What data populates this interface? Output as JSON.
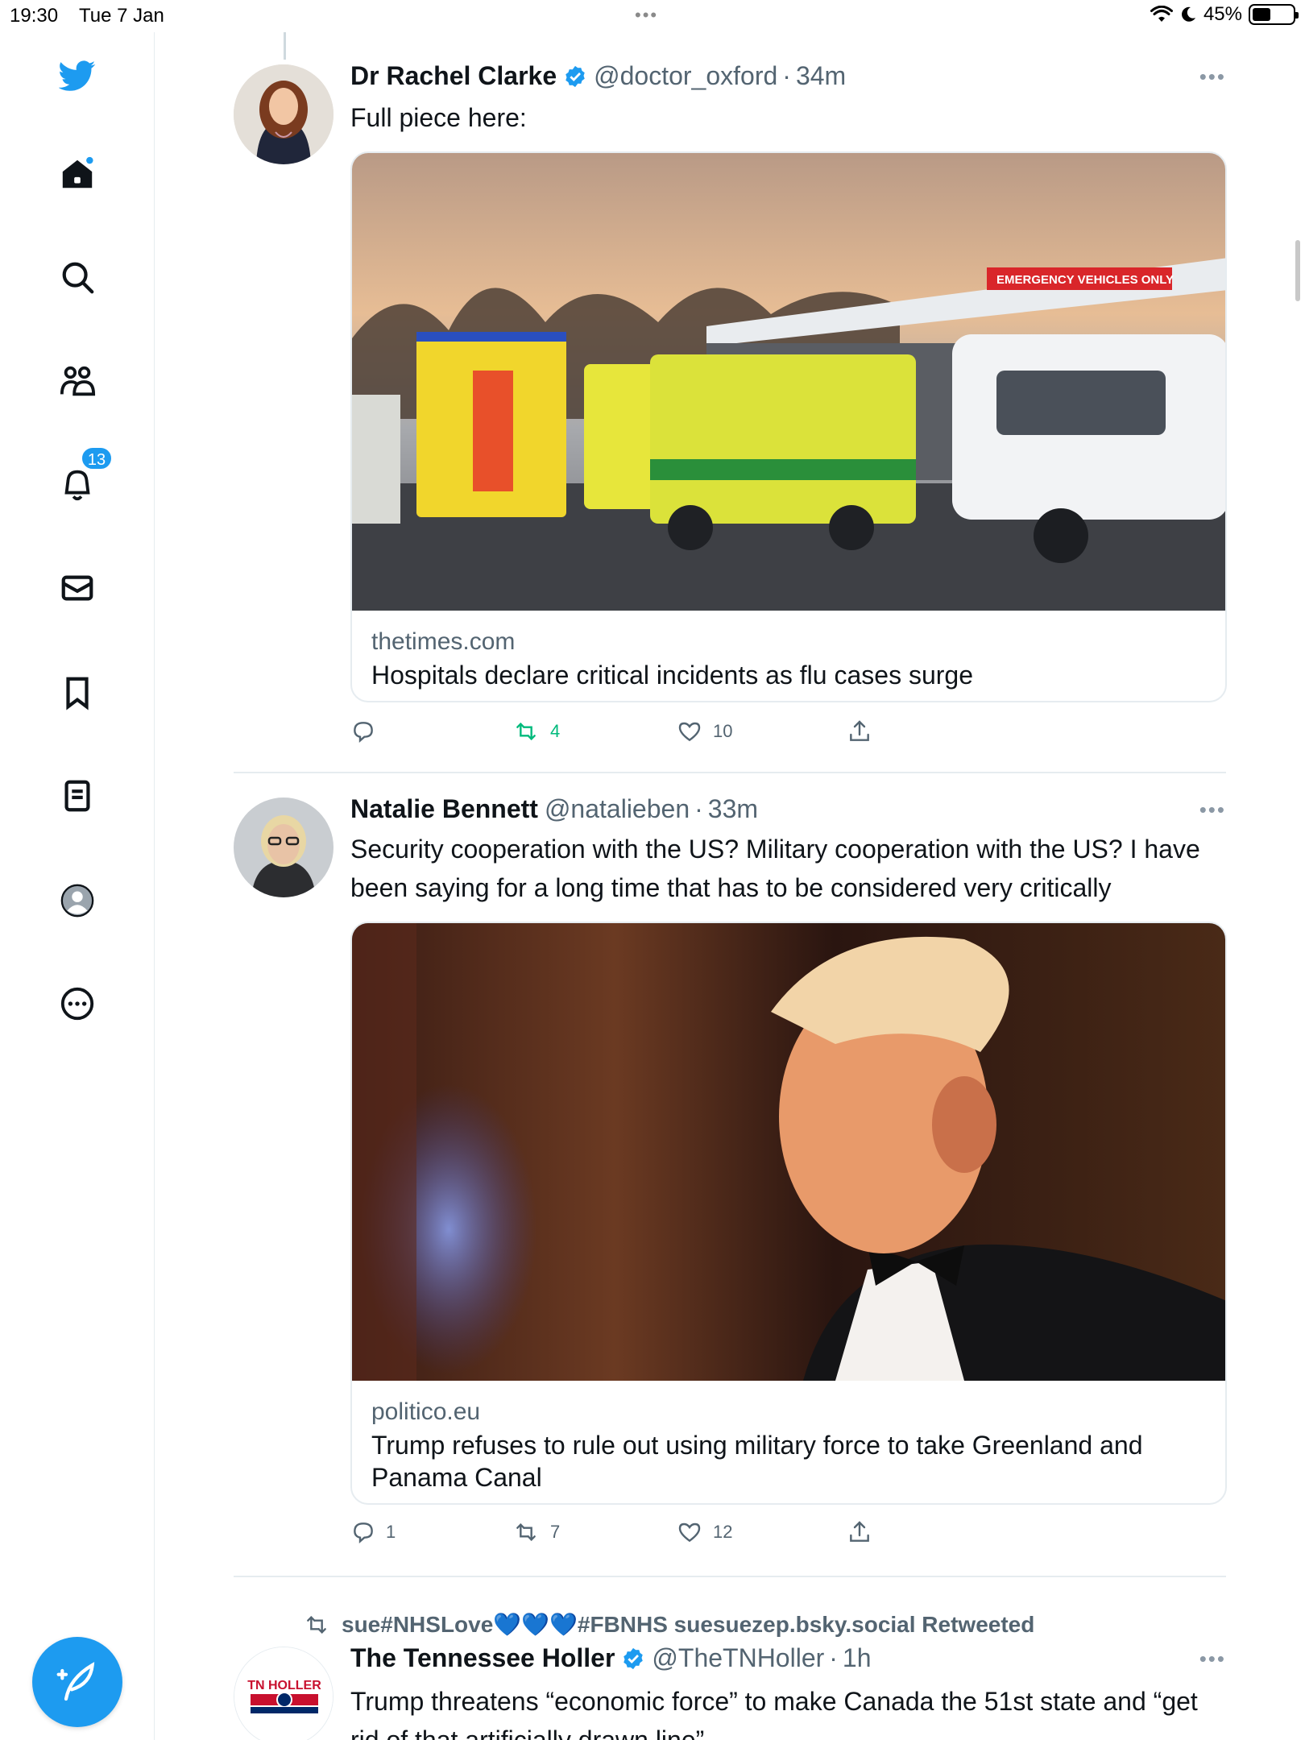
{
  "status_bar": {
    "time": "19:30",
    "date": "Tue 7 Jan",
    "battery": "45%",
    "battery_level": 0.45
  },
  "sidebar": {
    "notifications_badge": "13",
    "icons": [
      "twitter-logo-icon",
      "home-icon",
      "search-icon",
      "communities-icon",
      "notifications-icon",
      "messages-icon",
      "bookmarks-icon",
      "lists-icon",
      "profile-icon",
      "more-icon"
    ]
  },
  "compose": {
    "icon": "compose-feather-icon"
  },
  "tweets": [
    {
      "name": "Dr Rachel Clarke",
      "verified": true,
      "handle": "@doctor_oxford",
      "time": "34m",
      "text": "Full piece here:",
      "card": {
        "domain": "thetimes.com",
        "title": "Hospitals declare critical incidents as flu cases surge",
        "image_text": "EMERGENCY VEHICLES ONLY"
      },
      "actions": {
        "replies": "",
        "retweets": "4",
        "likes": "10"
      }
    },
    {
      "name": "Natalie Bennett",
      "verified": false,
      "handle": "@natalieben",
      "time": "33m",
      "text": "Security cooperation with the US? Military cooperation with the US? I have been saying for a long time that has to be considered very critically",
      "card": {
        "domain": "politico.eu",
        "title": "Trump refuses to rule out using military force to take Greenland and Panama Canal"
      },
      "actions": {
        "replies": "1",
        "retweets": "7",
        "likes": "12"
      }
    },
    {
      "retweeted_by": "sue#NHSLove💙💙💙#FBNHS suesuezep.bsky.social Retweeted",
      "name": "The Tennessee Holler",
      "verified": true,
      "handle": "@TheTNHoller",
      "time": "1h",
      "avatar_text": "TN HOLLER",
      "text": "Trump threatens “economic force” to make Canada the 51st state and “get rid of that artificially drawn line”"
    }
  ],
  "colors": {
    "accent": "#1d9bf0",
    "retweet_green": "#00ba7c",
    "secondary_text": "#536471",
    "border": "#e6ecf0"
  }
}
